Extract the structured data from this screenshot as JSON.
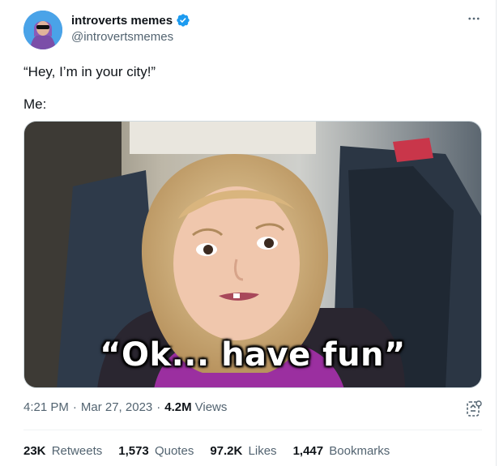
{
  "author": {
    "display_name": "introverts memes",
    "handle": "@introvertsmemes",
    "avatar_icon": "avatar-hooded-figure-sunglasses",
    "verified_icon": "verified-badge-icon",
    "verified_color": "#1d9bf0"
  },
  "more_icon": "more-options-icon",
  "post": {
    "line1": "“Hey, I’m in your city!”",
    "line2": "Me:"
  },
  "media": {
    "caption": "“Ok... have fun”"
  },
  "meta": {
    "time": "4:21 PM",
    "separator": "·",
    "date": "Mar 27, 2023",
    "views_count": "4.2M",
    "views_label": "Views",
    "grok_icon": "grok-icon"
  },
  "stats": [
    {
      "count": "23K",
      "label": "Retweets"
    },
    {
      "count": "1,573",
      "label": "Quotes"
    },
    {
      "count": "97.2K",
      "label": "Likes"
    },
    {
      "count": "1,447",
      "label": "Bookmarks"
    }
  ],
  "colors": {
    "text_primary": "#0f1419",
    "text_secondary": "#536471",
    "border": "#cfd9de"
  }
}
